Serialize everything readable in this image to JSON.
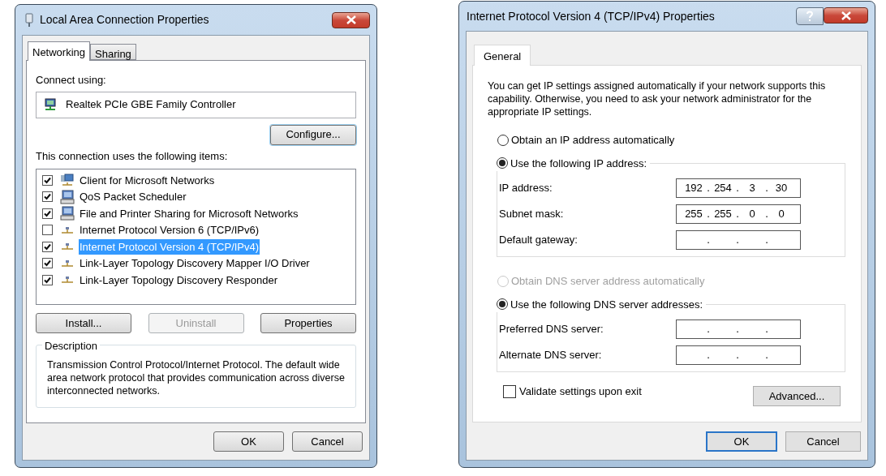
{
  "left_window": {
    "title": "Local Area Connection Properties",
    "tabs": [
      {
        "label": "Networking",
        "selected": true
      },
      {
        "label": "Sharing",
        "selected": false
      }
    ],
    "connect_using_label": "Connect using:",
    "adapter": "Realtek PCIe GBE Family Controller",
    "configure_button": "Configure...",
    "items_label": "This connection uses the following items:",
    "items": [
      {
        "label": "Client for Microsoft Networks",
        "checked": true,
        "selected": false,
        "kind": "client"
      },
      {
        "label": "QoS Packet Scheduler",
        "checked": true,
        "selected": false,
        "kind": "computer"
      },
      {
        "label": "File and Printer Sharing for Microsoft Networks",
        "checked": true,
        "selected": false,
        "kind": "computer"
      },
      {
        "label": "Internet Protocol Version 6 (TCP/IPv6)",
        "checked": false,
        "selected": false,
        "kind": "protocol"
      },
      {
        "label": "Internet Protocol Version 4 (TCP/IPv4)",
        "checked": true,
        "selected": true,
        "kind": "protocol"
      },
      {
        "label": "Link-Layer Topology Discovery Mapper I/O Driver",
        "checked": true,
        "selected": false,
        "kind": "protocol"
      },
      {
        "label": "Link-Layer Topology Discovery Responder",
        "checked": true,
        "selected": false,
        "kind": "protocol"
      }
    ],
    "item_buttons": [
      {
        "label": "Install...",
        "disabled": false
      },
      {
        "label": "Uninstall",
        "disabled": true
      },
      {
        "label": "Properties",
        "disabled": false
      }
    ],
    "description": {
      "title": "Description",
      "text": "Transmission Control Protocol/Internet Protocol. The default wide area network protocol that provides communication across diverse interconnected networks."
    },
    "buttons": [
      "OK",
      "Cancel"
    ]
  },
  "right_window": {
    "title": "Internet Protocol Version 4 (TCP/IPv4) Properties",
    "tabs": [
      {
        "label": "General",
        "selected": true
      }
    ],
    "intro": "You can get IP settings assigned automatically if your network supports this capability. Otherwise, you need to ask your network administrator for the appropriate IP settings.",
    "groups": [
      {
        "options": [
          {
            "label": "Obtain an IP address automatically",
            "selected": false,
            "disabled": false
          },
          {
            "label": "Use the following IP address:",
            "selected": true,
            "disabled": false
          }
        ],
        "fields": [
          {
            "label": "IP address:",
            "octets": [
              "192",
              "254",
              "3",
              "30"
            ],
            "dots": [
              ".",
              ".",
              "."
            ]
          },
          {
            "label": "Subnet mask:",
            "octets": [
              "255",
              "255",
              "0",
              "0"
            ],
            "dots": [
              ".",
              ".",
              "."
            ]
          },
          {
            "label": "Default gateway:",
            "dots": [
              ".",
              ".",
              "."
            ]
          }
        ]
      },
      {
        "options": [
          {
            "label": "Obtain DNS server address automatically",
            "selected": false,
            "disabled": true
          },
          {
            "label": "Use the following DNS server addresses:",
            "selected": true,
            "disabled": false
          }
        ],
        "fields": [
          {
            "label": "Preferred DNS server:",
            "dots": [
              ".",
              ".",
              "."
            ]
          },
          {
            "label": "Alternate DNS server:",
            "dots": [
              ".",
              ".",
              "."
            ]
          }
        ]
      }
    ],
    "validate": {
      "label": "Validate settings upon exit",
      "checked": false
    },
    "advanced_button": "Advanced...",
    "buttons": [
      "OK",
      "Cancel"
    ]
  }
}
